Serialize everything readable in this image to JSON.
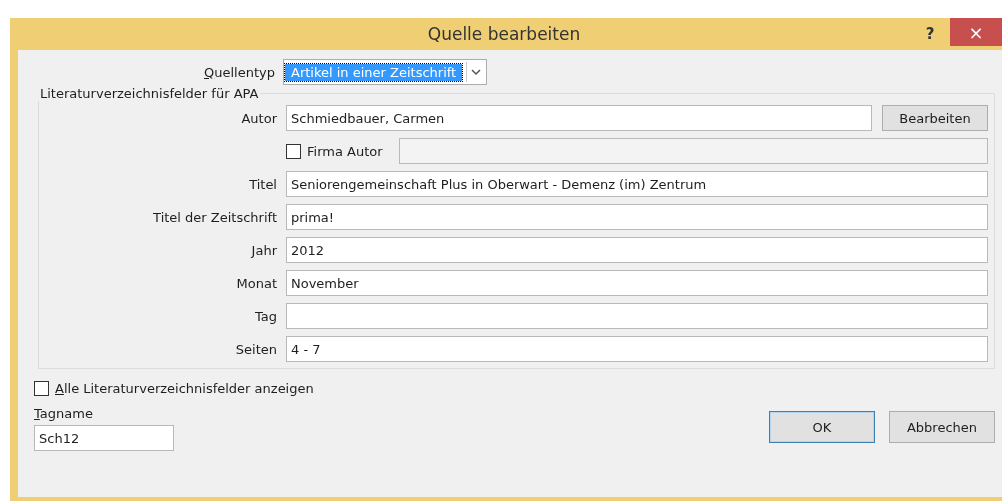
{
  "window": {
    "title": "Quelle bearbeiten",
    "help": "?",
    "close": "×"
  },
  "source_type": {
    "label": "Quellentyp",
    "value": "Artikel in einer Zeitschrift",
    "selected": true
  },
  "group": {
    "title": "Literaturverzeichnisfelder für APA",
    "author": {
      "label": "Autor",
      "value": "Schmiedbauer, Carmen",
      "button": "Bearbeiten"
    },
    "corporate": {
      "label": "Firma Autor",
      "checked": false
    },
    "fields": [
      {
        "label": "Titel",
        "value": "Seniorengemeinschaft Plus in Oberwart - Demenz (im) Zentrum"
      },
      {
        "label": "Titel der Zeitschrift",
        "value": "prima!"
      },
      {
        "label": "Jahr",
        "value": "2012"
      },
      {
        "label": "Monat",
        "value": "November"
      },
      {
        "label": "Tag"
      },
      {
        "label": "Seiten",
        "value": "4 - 7"
      }
    ]
  },
  "show_all": {
    "label": "Alle Literaturverzeichnisfelder anzeigen",
    "checked": false
  },
  "tag": {
    "label": "Tagname",
    "value": "Sch12"
  },
  "buttons": [
    {
      "label": "OK",
      "default": true
    },
    {
      "label": "Abbrechen",
      "default": false
    }
  ]
}
